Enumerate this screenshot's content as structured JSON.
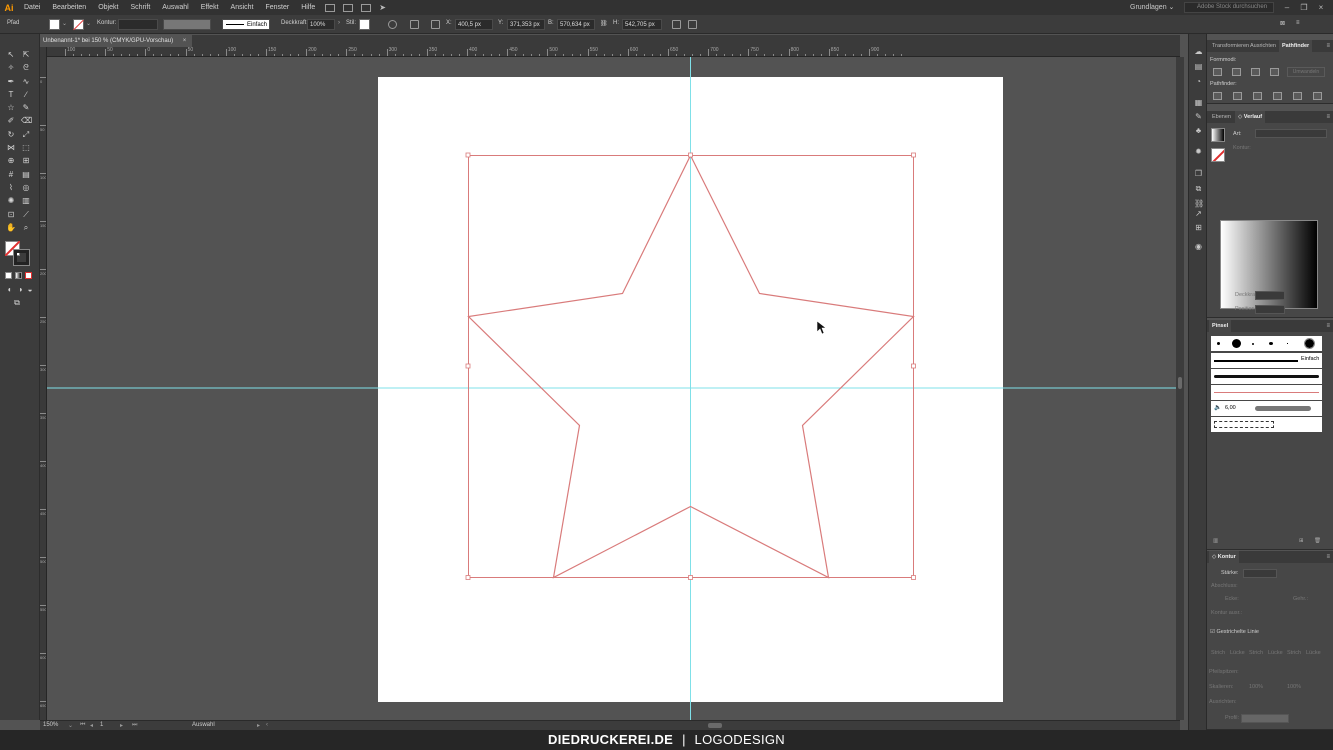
{
  "app": {
    "logo": "Ai"
  },
  "menubar": {
    "items": [
      "Datei",
      "Bearbeiten",
      "Objekt",
      "Schrift",
      "Auswahl",
      "Effekt",
      "Ansicht",
      "Fenster",
      "Hilfe"
    ],
    "workspace": "Grundlagen",
    "stock_search_placeholder": "Adobe Stock durchsuchen"
  },
  "controlbar": {
    "selection": "Pfad",
    "kontur_label": "Kontur:",
    "stroke_profile": "Einfach",
    "deckkraft_label": "Deckkraft:",
    "deckkraft_value": "100%",
    "stil_label": "Stil:",
    "x_label": "X:",
    "x_value": "400,5 px",
    "y_label": "Y:",
    "y_value": "371,353 px",
    "b_label": "B:",
    "b_value": "570,634 px",
    "h_label": "H:",
    "h_value": "542,705 px"
  },
  "document": {
    "tab_title": "Unbenannt-1* bei 150 % (CMYK/GPU-Vorschau)",
    "close": "×"
  },
  "ruler": {
    "h_labels": [
      "100",
      "50",
      "0",
      "50",
      "100",
      "150",
      "200",
      "250",
      "300",
      "350",
      "400",
      "450",
      "500",
      "550",
      "600",
      "650",
      "700",
      "750",
      "800",
      "850",
      "900"
    ],
    "v_labels": [
      "0",
      "50",
      "100",
      "150",
      "200",
      "250",
      "300",
      "350",
      "400",
      "450",
      "500",
      "550",
      "600",
      "650"
    ]
  },
  "statusbar": {
    "zoom": "150%",
    "artboard_index": "1",
    "tool_name": "Auswahl"
  },
  "panels": {
    "transform_tabs": [
      "Transformieren",
      "Ausrichten",
      "Pathfinder"
    ],
    "formmodi_label": "Formmodi:",
    "umwandeln_label": "Umwandeln",
    "pathfinder_label": "Pathfinder:",
    "gradient_tabs": [
      "Ebenen",
      "Verlauf"
    ],
    "gradient_art_label": "Art:",
    "gradient_kontur_label": "Kontur:",
    "gradient_deckkraft_label": "Deckkraft:",
    "gradient_position_label": "Position:",
    "pinsel_tab": "Pinsel",
    "pinsel_einfach": "Einfach",
    "pinsel_size": "6,00",
    "kontur_tab": "Kontur",
    "staerke_label": "Stärke:",
    "abschluss_label": "Abschluss:",
    "ecke_label": "Ecke:",
    "gehrung_label": "Gehr.:",
    "ausr_label": "Kontur ausr.:",
    "gestrichelt_label": "Gestrichelte Linie",
    "dash_labels": [
      "Strich",
      "Lücke",
      "Strich",
      "Lücke",
      "Strich",
      "Lücke"
    ],
    "pfeilspitzen_label": "Pfeilspitzen:",
    "skalierung_label": "Skalieren:",
    "skal_value1": "100%",
    "skal_value2": "100%",
    "ausrichten_label": "Ausrichten:",
    "profil_label": "Profil:"
  },
  "brand": {
    "bold": "DIEDRUCKEREI.DE",
    "sep": "|",
    "light": "LOGODESIGN"
  },
  "colors": {
    "selection": "#d97b7b",
    "guide": "#7fe0e8",
    "accent": "#ff9a00"
  },
  "icons": {
    "cursor": "arrow-cursor-icon",
    "fill": "fill-swatch-icon",
    "stroke": "stroke-swatch-icon"
  }
}
